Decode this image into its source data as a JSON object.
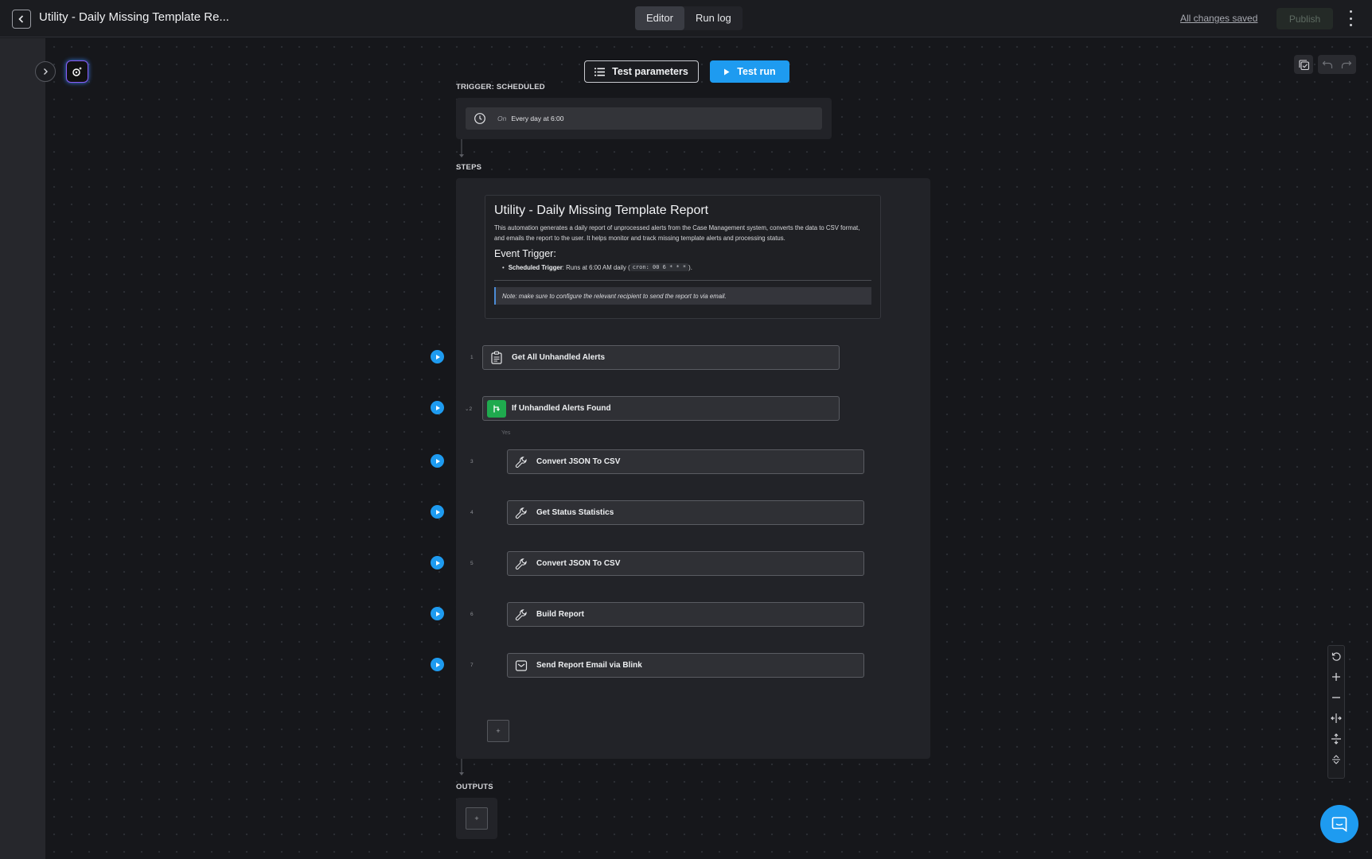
{
  "header": {
    "title": "Utility - Daily Missing Template Re...",
    "tabs": [
      {
        "label": "Editor",
        "active": true
      },
      {
        "label": "Run log",
        "active": false
      }
    ],
    "saved_status": "All changes saved",
    "publish_label": "Publish"
  },
  "toolbar": {
    "test_parameters_label": "Test parameters",
    "test_run_label": "Test run"
  },
  "trigger": {
    "section_label": "TRIGGER: SCHEDULED",
    "on_label": "On",
    "schedule": "Every day at 6:00"
  },
  "steps_section_label": "STEPS",
  "note": {
    "title": "Utility - Daily Missing Template Report",
    "description": "This automation generates a daily report of unprocessed alerts from the Case Management system, converts the data to CSV format, and emails the report to the user. It helps monitor and track missing template alerts and processing status.",
    "subtitle": "Event Trigger:",
    "bullet_bold": "Scheduled Trigger",
    "bullet_text": ": Runs at 6:00 AM daily (",
    "bullet_code": "cron: 00 6 * * *",
    "bullet_end": ").",
    "quote": "Note: make sure to configure the relevant recipient to send the report to via email."
  },
  "branch_label": "Yes",
  "steps": [
    {
      "num": "1",
      "label": "Get All Unhandled Alerts",
      "icon": "clipboard-icon"
    },
    {
      "num": "2",
      "label": "If Unhandled Alerts Found",
      "icon": "branch-icon"
    },
    {
      "num": "3",
      "label": "Convert JSON To CSV",
      "icon": "wrench-icon"
    },
    {
      "num": "4",
      "label": "Get Status Statistics",
      "icon": "wrench-icon"
    },
    {
      "num": "5",
      "label": "Convert JSON To CSV",
      "icon": "wrench-icon"
    },
    {
      "num": "6",
      "label": "Build Report",
      "icon": "wrench-icon"
    },
    {
      "num": "7",
      "label": "Send Report Email via Blink",
      "icon": "mail-icon"
    }
  ],
  "add_label": "+",
  "outputs_section_label": "OUTPUTS",
  "colors": {
    "accent": "#1e9bf0",
    "condition": "#1faa4e",
    "background": "#16171b"
  }
}
